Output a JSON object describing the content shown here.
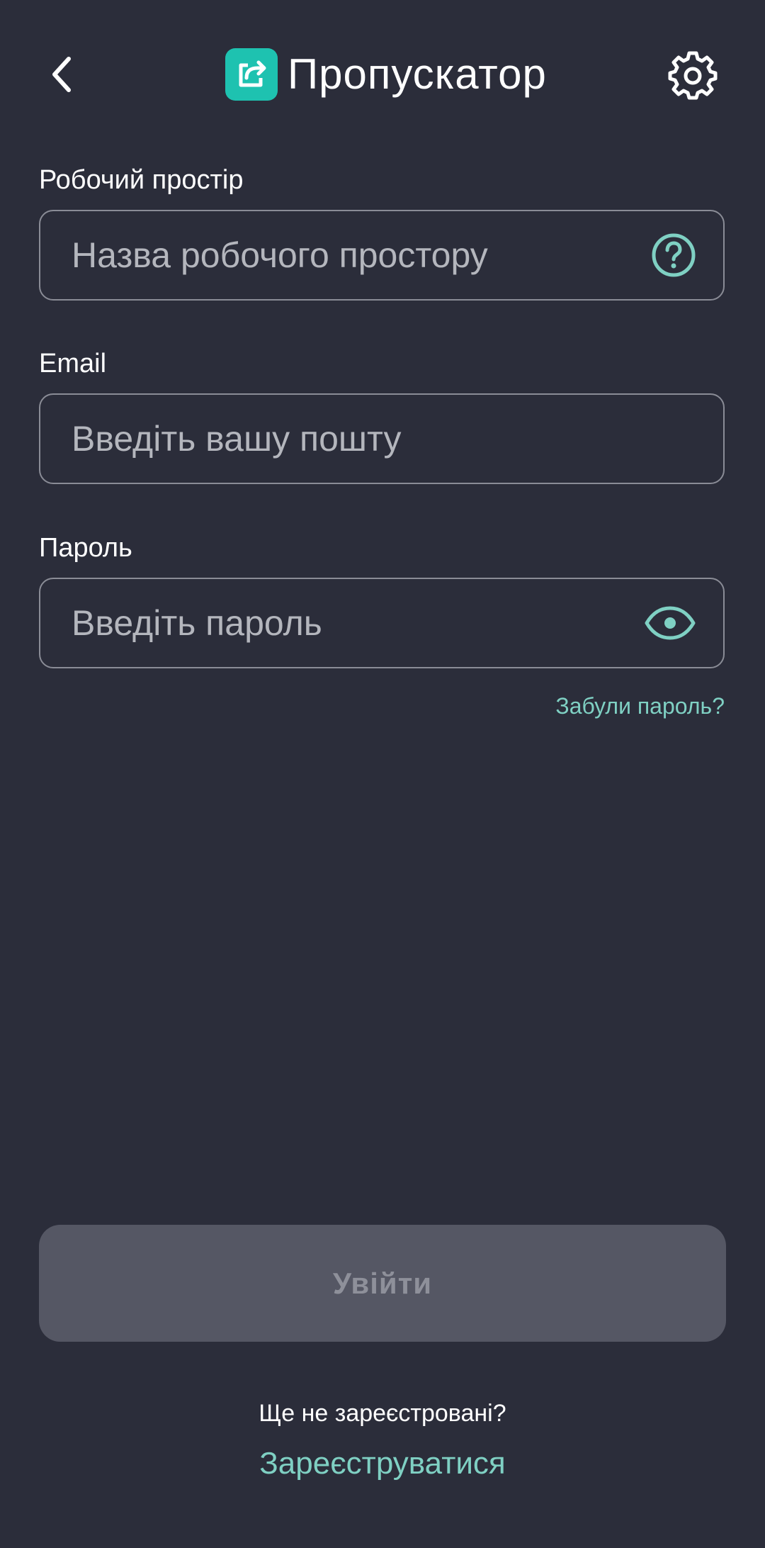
{
  "header": {
    "back_icon": "chevron-left-icon",
    "brand_logo_icon": "share-arrow-icon",
    "brand_name": "Пропускатор",
    "settings_icon": "gear-icon",
    "brand_color": "#1ec2b0"
  },
  "form": {
    "workspace": {
      "label": "Робочий простір",
      "value": "",
      "placeholder": "Назва робочого простору",
      "help_icon": "question-circle-icon"
    },
    "email": {
      "label": "Email",
      "value": "",
      "placeholder": "Введіть вашу пошту"
    },
    "password": {
      "label": "Пароль",
      "value": "",
      "placeholder": "Введіть пароль",
      "toggle_icon": "eye-icon"
    },
    "forgot_password": "Забули пароль?"
  },
  "actions": {
    "login_label": "Увійти",
    "not_registered": "Ще не зареєстровані?",
    "register_label": "Зареєструватися"
  },
  "colors": {
    "background": "#2b2d3a",
    "accent": "#7fd0c3",
    "disabled_button": "#555764"
  }
}
